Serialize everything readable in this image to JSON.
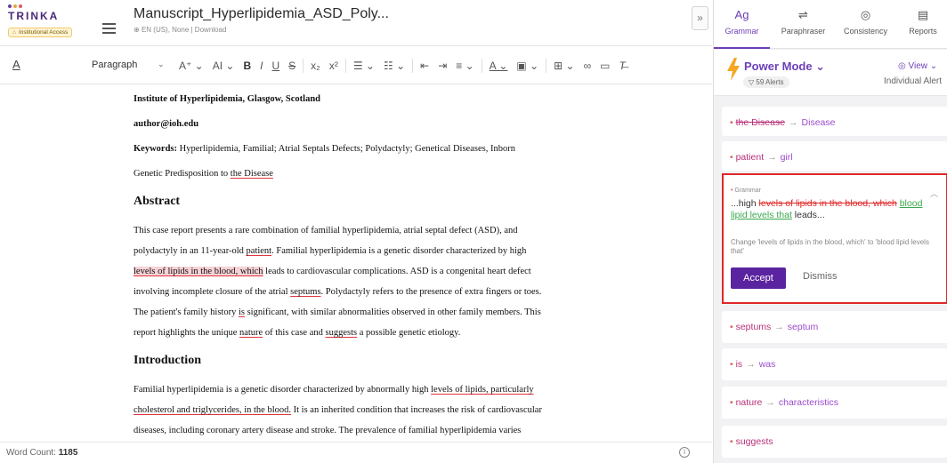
{
  "header": {
    "logo_text": "TRINKA",
    "institution_badge": "Institutional Access",
    "doc_title": "Manuscript_Hyperlipidemia_ASD_Poly...",
    "doc_meta": "EN (US), None  |  Download",
    "collapse_label": "»"
  },
  "toolbar": {
    "text_style_icon": "A",
    "paragraph_label": "Paragraph",
    "icons": [
      "font-size-icon",
      "font-case-icon",
      "bold-icon",
      "italic-icon",
      "underline-icon",
      "strikethrough-icon",
      "subscript-icon",
      "superscript-icon",
      "bullet-list-icon",
      "numbered-list-icon",
      "outdent-icon",
      "indent-icon",
      "align-icon",
      "text-color-icon",
      "highlight-icon",
      "table-icon",
      "link-icon",
      "image-icon",
      "clear-format-icon"
    ]
  },
  "editor": {
    "affiliation": "Institute of Hyperlipidemia, Glasgow, Scotland",
    "email": "author@ioh.edu",
    "keywords_label": "Keywords:",
    "keywords": "Hyperlipidemia, Familial; Atrial Septals Defects; Polydactyly; Genetical Diseases, Inborn",
    "keywords_line2_pre": "Genetic Predisposition to ",
    "keywords_line2_err": "the Disease",
    "abstract_heading": "Abstract",
    "abs_l1": "This case report presents a rare combination of familial hyperlipidemia, atrial septal defect (ASD), and",
    "abs_l2_pre": "polydactyly in an 11-year-old ",
    "abs_l2_err": "patient",
    "abs_l2_post": ". Familial hyperlipidemia is a genetic disorder characterized by high",
    "abs_l3_hl": "levels of lipids in the blood, which",
    "abs_l3_post": " leads to cardiovascular complications. ASD is a congenital heart defect",
    "abs_l4_pre": "involving incomplete closure of the atrial ",
    "abs_l4_err": "septums",
    "abs_l4_post": ". Polydactyly refers to the presence of extra fingers or toes.",
    "abs_l5_pre": "The patient's family history ",
    "abs_l5_err": "is",
    "abs_l5_post": " significant, with similar abnormalities observed in other family members. This",
    "abs_l6_pre": "report highlights the unique ",
    "abs_l6_err1": "nature",
    "abs_l6_mid": " of this case and ",
    "abs_l6_err2": "suggests",
    "abs_l6_post": " a possible genetic etiology.",
    "intro_heading": "Introduction",
    "int_l1_pre": "Familial hyperlipidemia is a genetic disorder characterized by abnormally high ",
    "int_l1_err": "levels of lipids, particularly",
    "int_l2_err": "cholesterol and triglycerides, in the blood.",
    "int_l2_post": " It is an inherited condition that increases the risk of cardiovascular",
    "int_l3": "diseases, including coronary artery disease and stroke. The prevalence of familial hyperlipidemia varies"
  },
  "footer": {
    "word_count_label": "Word Count: ",
    "word_count": "1185",
    "info_icon": "i"
  },
  "panel": {
    "tabs": [
      {
        "label": "Grammar",
        "icon": "grammar-icon"
      },
      {
        "label": "Paraphraser",
        "icon": "paraphraser-icon"
      },
      {
        "label": "Consistency",
        "icon": "consistency-icon"
      },
      {
        "label": "Reports",
        "icon": "reports-icon"
      }
    ],
    "power_mode": "Power Mode ⌄",
    "alerts": "▽ 59 Alerts",
    "view": "◎ View ⌄",
    "view_mode": "Individual Alert",
    "suggestions": [
      {
        "old": "the Disease",
        "new": "Disease",
        "strike": true
      },
      {
        "old": "patient",
        "new": "girl",
        "strike": false
      },
      {
        "old": "septums",
        "new": "septum",
        "strike": false
      },
      {
        "old": "is",
        "new": "was",
        "strike": false
      },
      {
        "old": "nature",
        "new": "characteristics",
        "strike": false
      },
      {
        "old": "suggests",
        "new": "",
        "strike": false
      }
    ],
    "active": {
      "tag": "Grammar",
      "prefix": "...high ",
      "deleted": "levels of lipids in the blood, which",
      "inserted": "blood lipid levels that",
      "suffix": " leads...",
      "explanation": "Change 'levels of lipids in the blood, which' to 'blood lipid levels that'",
      "accept": "Accept",
      "dismiss": "Dismiss"
    }
  }
}
